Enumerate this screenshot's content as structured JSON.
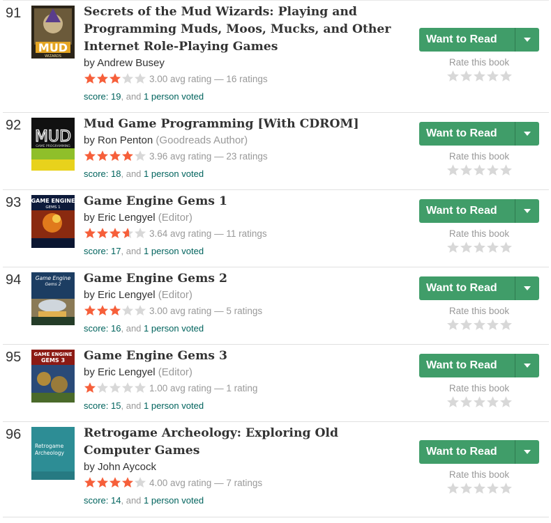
{
  "ui": {
    "want_to_read": "Want to Read",
    "rate_this_book": "Rate this book",
    "score_prefix": "score:",
    "and": ", and",
    "voted_suffix": "person voted",
    "colors": {
      "star_filled": "#f65f3a",
      "star_empty": "#d8d8d8",
      "button_green": "#409d69",
      "link_teal": "#00635d"
    }
  },
  "books": [
    {
      "rank": "91",
      "title": "Secrets of the Mud Wizards: Playing and Programming Muds, Moos, Mucks, and Other Internet Role-Playing Games",
      "author": "Andrew Busey",
      "role": "",
      "stars": 3.0,
      "rating_text": "3.00 avg rating — 16 ratings",
      "score": "score: 19",
      "voters": "1",
      "cover_text": "MUD",
      "cover_subtext": "WIZARDS"
    },
    {
      "rank": "92",
      "title": "Mud Game Programming [With CDROM]",
      "author": "Ron Penton",
      "role": "(Goodreads Author)",
      "stars": 3.96,
      "rating_text": "3.96 avg rating — 23 ratings",
      "score": "score: 18",
      "voters": "1",
      "cover_text": "MUD",
      "cover_subtext": "GAME PROGRAMMING"
    },
    {
      "rank": "93",
      "title": "Game Engine Gems 1",
      "author": "Eric Lengyel",
      "role": "(Editor)",
      "stars": 3.64,
      "rating_text": "3.64 avg rating — 11 ratings",
      "score": "score: 17",
      "voters": "1",
      "cover_text": "GAME ENGINE",
      "cover_subtext": "GEMS 1"
    },
    {
      "rank": "94",
      "title": "Game Engine Gems 2",
      "author": "Eric Lengyel",
      "role": "(Editor)",
      "stars": 3.0,
      "rating_text": "3.00 avg rating — 5 ratings",
      "score": "score: 16",
      "voters": "1",
      "cover_text": "Game Engine",
      "cover_subtext": "Gems 2"
    },
    {
      "rank": "95",
      "title": "Game Engine Gems 3",
      "author": "Eric Lengyel",
      "role": "(Editor)",
      "stars": 1.0,
      "rating_text": "1.00 avg rating — 1 rating",
      "score": "score: 15",
      "voters": "1",
      "cover_text": "GAME ENGINE",
      "cover_subtext": "GEMS 3"
    },
    {
      "rank": "96",
      "title": "Retrogame Archeology: Exploring Old Computer Games",
      "author": "John Aycock",
      "role": "",
      "stars": 4.0,
      "rating_text": "4.00 avg rating — 7 ratings",
      "score": "score: 14",
      "voters": "1",
      "cover_text": "Retrogame Archeology",
      "cover_subtext": ""
    }
  ]
}
